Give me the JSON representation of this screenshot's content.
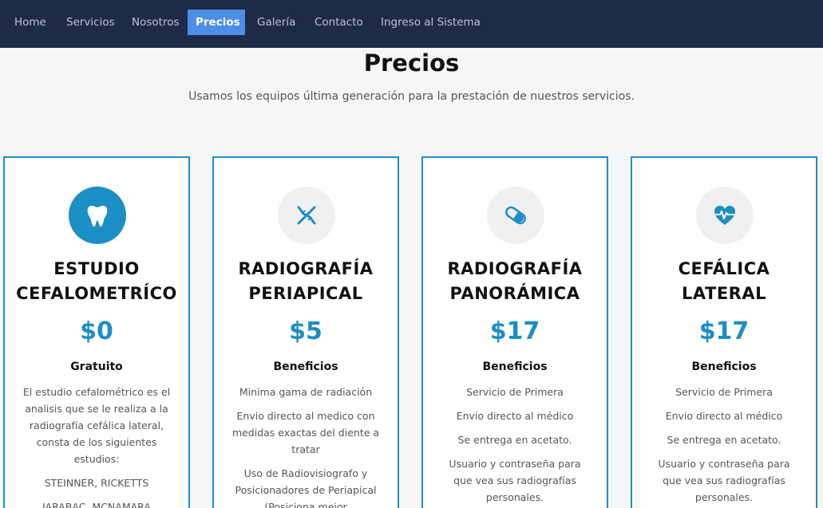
{
  "nav": {
    "items": [
      {
        "label": "Home"
      },
      {
        "label": "Servicios"
      },
      {
        "label": "Nosotros"
      },
      {
        "label": "Precios",
        "active": true
      },
      {
        "label": "Galería"
      },
      {
        "label": "Contacto"
      },
      {
        "label": "Ingreso al Sistema"
      }
    ]
  },
  "section": {
    "title": "Precios",
    "subtitle": "Usamos los equipos última generación para la prestación de nuestros servicios."
  },
  "colors": {
    "navbar": "#1f2a47",
    "active_nav": "#4d8ee8",
    "accent": "#1b8fc6"
  },
  "cards": [
    {
      "icon": "tooth-icon",
      "title_line1": "ESTUDIO",
      "title_line2": "CEFALOMETRÍCO",
      "price": "$0",
      "subtitle": "Gratuito",
      "features": [
        "El estudio cefalométrico es el analisis que se le realiza a la radiografía cefálica lateral, consta de los siguientes estudios:",
        "STEINNER, RICKETTS",
        "JARABAC, MCNAMARA"
      ]
    },
    {
      "icon": "dna-icon",
      "title_line1": "RADIOGRAFÍA",
      "title_line2": "PERIAPICAL",
      "price": "$5",
      "subtitle": "Beneficios",
      "features": [
        "Minima gama de radiación",
        "Envio directo al medico con medidas exactas del diente a tratar",
        "Uso de Radiovisiografo y Posicionadores de Periapical (Posiciona mejor"
      ]
    },
    {
      "icon": "pill-icon",
      "title_line1": "RADIOGRAFÍA",
      "title_line2": "PANORÁMICA",
      "price": "$17",
      "subtitle": "Beneficios",
      "features": [
        "Servicio de Primera",
        "Envio directo al médico",
        "Se entrega en acetato.",
        "Usuario y contraseña para que vea sus radiografías personales."
      ]
    },
    {
      "icon": "heartbeat-icon",
      "title_line1": "CEFÁLICA",
      "title_line2": "LATERAL",
      "price": "$17",
      "subtitle": "Beneficios",
      "features": [
        "Servicio de Primera",
        "Envio directo al médico",
        "Se entrega en acetato.",
        "Usuario y contraseña para que vea sus radiografías personales."
      ]
    }
  ]
}
